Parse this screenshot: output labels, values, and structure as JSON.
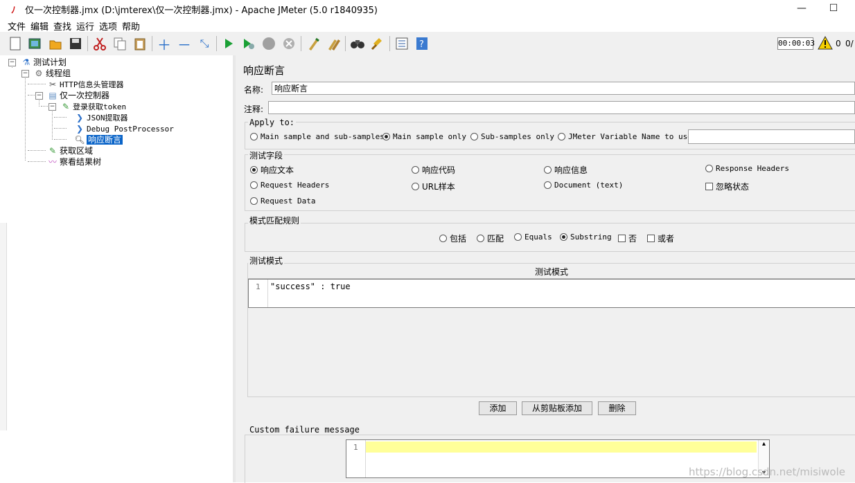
{
  "window": {
    "title": "仅一次控制器.jmx (D:\\jmterex\\仅一次控制器.jmx) - Apache JMeter (5.0 r1840935)",
    "minimize": "—",
    "maximize": "☐"
  },
  "menu": [
    "文件",
    "编辑",
    "查找",
    "运行",
    "选项",
    "帮助"
  ],
  "toolbar": {
    "timer": "00:00:03",
    "warning_count": "0",
    "threads": "0/"
  },
  "tree": {
    "items": [
      {
        "label": "测试计划",
        "icon": "flask-icon"
      },
      {
        "label": "线程组",
        "icon": "gear-icon"
      },
      {
        "label": "HTTP信息头管理器",
        "icon": "wrench-icon"
      },
      {
        "label": "仅一次控制器",
        "icon": "controller-icon"
      },
      {
        "label": "登录获取token",
        "icon": "sampler-icon"
      },
      {
        "label": "JSON提取器",
        "icon": "extractor-icon"
      },
      {
        "label": "Debug PostProcessor",
        "icon": "postprocessor-icon"
      },
      {
        "label": "响应断言",
        "icon": "magnifier-icon"
      },
      {
        "label": "获取区域",
        "icon": "sampler-icon"
      },
      {
        "label": "察看结果树",
        "icon": "listener-icon"
      }
    ]
  },
  "assertion": {
    "panel_title": "响应断言",
    "name_label": "名称:",
    "name_value": "响应断言",
    "comment_label": "注释:",
    "comment_value": "",
    "apply_to": {
      "title": "Apply to:",
      "options": [
        "Main sample and sub-samples",
        "Main sample only",
        "Sub-samples only",
        "JMeter Variable Name to use"
      ],
      "selected": "Main sample only",
      "variable_value": ""
    },
    "field_to_test": {
      "title": "测试字段",
      "options": [
        "响应文本",
        "响应代码",
        "响应信息",
        "Response Headers",
        "Request Headers",
        "URL样本",
        "Document (text)",
        "Request Data"
      ],
      "selected": "响应文本",
      "ignore_status_label": "忽略状态"
    },
    "pattern_matching": {
      "title": "模式匹配规则",
      "options": [
        "包括",
        "匹配",
        "Equals",
        "Substring"
      ],
      "selected": "Substring",
      "not_label": "否",
      "or_label": "或者"
    },
    "patterns": {
      "title": "测试模式",
      "column_header": "测试模式",
      "rows": [
        {
          "line": "1",
          "text": "\"success\" : true"
        }
      ],
      "add_button": "添加",
      "add_clipboard_button": "从剪贴板添加",
      "delete_button": "删除"
    },
    "custom_failure": {
      "title": "Custom failure message",
      "line": "1",
      "text": ""
    }
  },
  "watermark": "https://blog.csdn.net/misiwole",
  "colors": {
    "selection": "#0a64c8",
    "editor_highlight": "#ffff99",
    "run_green": "#1aa035"
  }
}
